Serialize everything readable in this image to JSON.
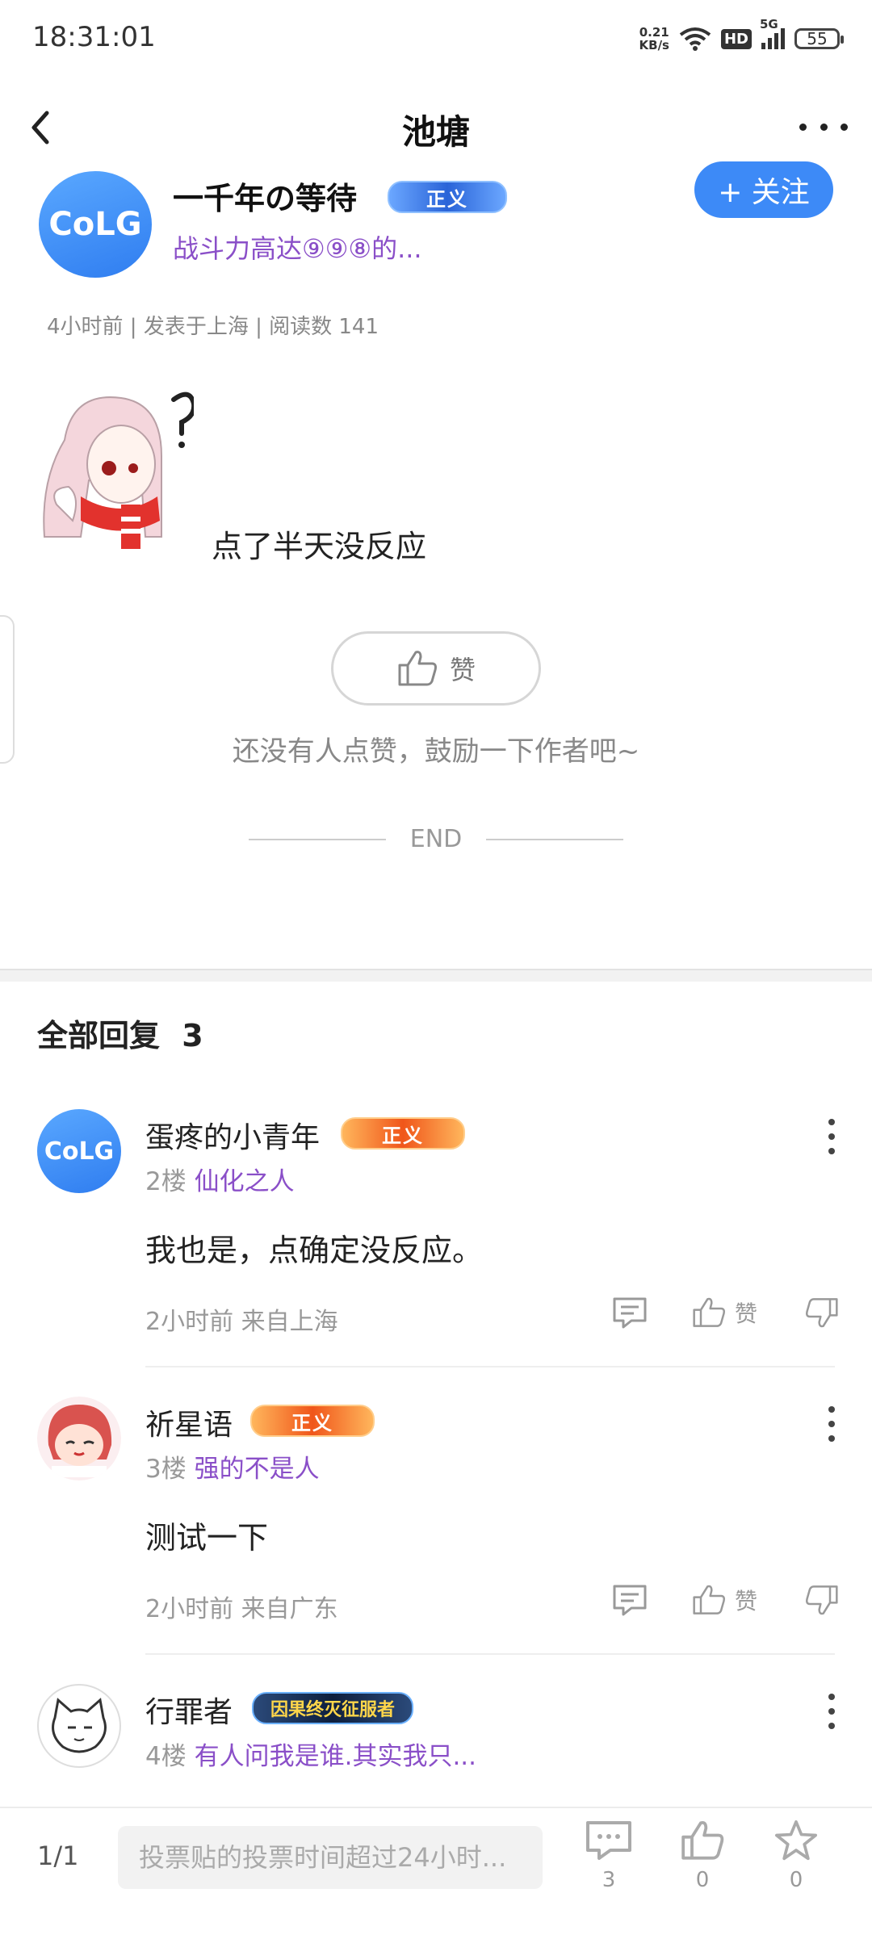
{
  "status_bar": {
    "time": "18:31:01",
    "net_speed": "0.21",
    "net_unit": "KB/s",
    "hd": "HD",
    "signal": "5G",
    "battery": "55"
  },
  "header": {
    "title": "池塘"
  },
  "post": {
    "author": {
      "avatar_text": "CoLG",
      "name": "一千年の等待",
      "badge": "正义",
      "title": "战斗力高达⑨⑨⑧的..."
    },
    "follow_label": "+ 关注",
    "meta": "4小时前 | 发表于上海 | 阅读数 141",
    "text": "点了半天没反应",
    "like_label": "赞",
    "like_hint": "还没有人点赞，鼓励一下作者吧~",
    "end_label": "END"
  },
  "replies_section": {
    "title": "全部回复",
    "count": "3"
  },
  "replies": [
    {
      "avatar_text": "CoLG",
      "name": "蛋疼的小青年",
      "badge": "正义",
      "floor": "2楼",
      "user_title": "仙化之人",
      "body": "我也是，点确定没反应。",
      "time_place": "2小时前 来自上海",
      "like_label": "赞"
    },
    {
      "avatar_text": "",
      "name": "祈星语",
      "badge": "正义",
      "floor": "3楼",
      "user_title": "强的不是人",
      "body": "测试一下",
      "time_place": "2小时前 来自广东",
      "like_label": "赞"
    },
    {
      "avatar_text": "",
      "name": "行罪者",
      "badge": "因果终灭征服者",
      "floor": "4楼",
      "user_title": "有人问我是谁.其实我只...",
      "body": "",
      "time_place": "",
      "like_label": ""
    }
  ],
  "bottom_bar": {
    "page": "1/1",
    "input_placeholder": "投票贴的投票时间超过24小时...",
    "comment_count": "3",
    "like_count": "0",
    "star_count": "0"
  },
  "icons": {
    "back": "chevron-left-icon",
    "more": "more-dots-icon",
    "like": "thumbs-up-icon",
    "dislike": "thumbs-down-icon",
    "comment": "comment-icon",
    "star": "star-icon"
  },
  "colors": {
    "accent": "#3d8af7",
    "user_title": "#8a4fc8"
  }
}
